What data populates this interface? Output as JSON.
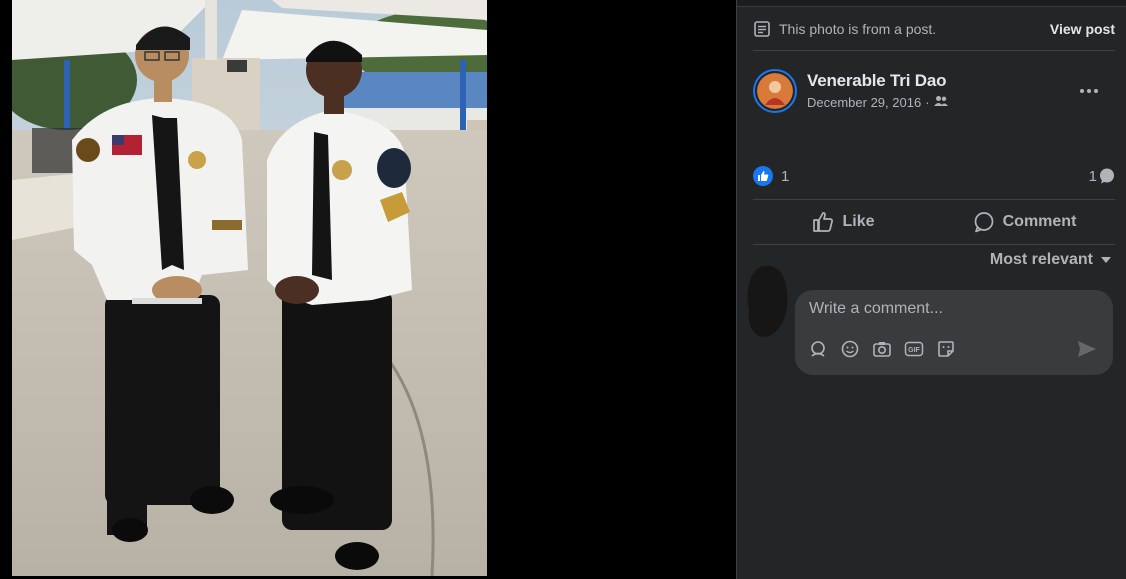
{
  "post_notice": {
    "text": "This photo is from a post.",
    "link": "View post"
  },
  "author": {
    "name": "Venerable Tri Dao",
    "date": "December 29, 2016",
    "date_separator": "·"
  },
  "reactions": {
    "like_count": "1",
    "comment_count": "1"
  },
  "actions": {
    "like": "Like",
    "comment": "Comment"
  },
  "sort": {
    "label": "Most relevant"
  },
  "comment_composer": {
    "placeholder": "Write a comment..."
  },
  "icons": {
    "notice": "document-icon",
    "audience": "friends-icon",
    "more": "more-options-icon",
    "reaction": "like-reaction-icon",
    "comments": "comment-bubble-icon",
    "like_action": "thumbs-up-icon",
    "comment_action": "comment-icon",
    "avatar_sticker": "avatar-sticker-icon",
    "emoji": "emoji-icon",
    "camera": "camera-icon",
    "gif": "gif-icon",
    "sticker": "sticker-icon",
    "send": "send-icon"
  },
  "colors": {
    "panel_bg": "#242526",
    "accent": "#1877f2",
    "composer_bg": "#3a3b3c",
    "text_primary": "#e4e6eb",
    "text_secondary": "#b0b3b8"
  }
}
